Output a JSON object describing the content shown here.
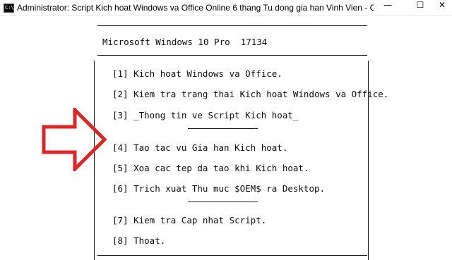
{
  "window": {
    "title": "Administrator:  Script Kich hoat Windows va Office Online 6 thang Tu dong gia han Vinh Vien - Copy...",
    "icon_label": "C:\\",
    "minimize_glyph": "—",
    "maximize_glyph": "☐",
    "close_glyph": "✕"
  },
  "console": {
    "os_info": "Microsoft Windows 10 Pro  17134",
    "menu": [
      {
        "text": "[1] Kich hoat Windows va Office."
      },
      {
        "text": "[2] Kiem tra trang thai Kich hoat Windows va Office."
      },
      {
        "text": "[3] _Thong tin ve Script Kich hoat_"
      },
      {
        "text": "[4] Tao tac vu Gia han Kich hoat."
      },
      {
        "text": "[5] Xoa cac tep da tao khi Kich hoat."
      },
      {
        "text": "[6] Trich xuat Thu muc $OEM$ ra Desktop."
      },
      {
        "text": "[7] Kiem tra Cap nhat Script."
      },
      {
        "text": "[8] Thoat."
      }
    ]
  },
  "annotation": {
    "arrow_icon": "red-outline-arrow-right",
    "arrow_color": "#e02424"
  }
}
